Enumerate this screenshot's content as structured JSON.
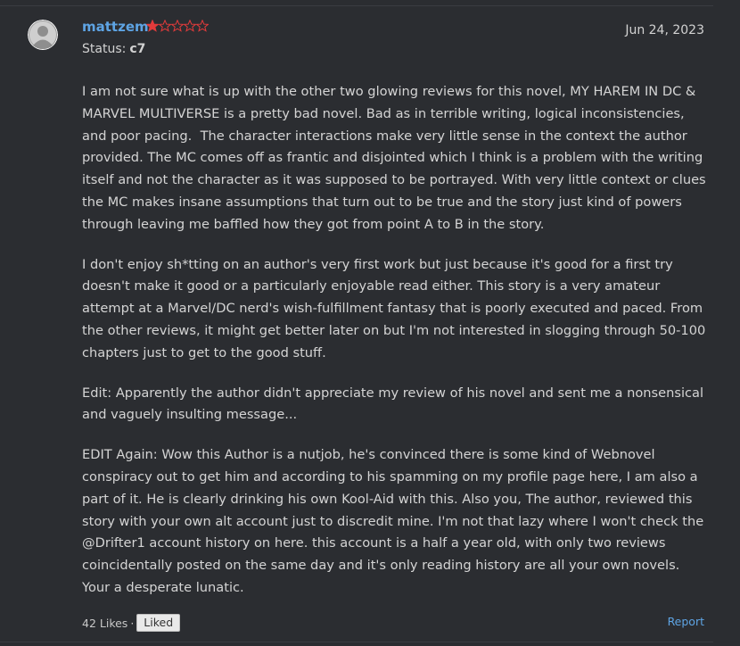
{
  "review": {
    "username": "mattzem",
    "rating": 1,
    "rating_max": 5,
    "status_label": "Status:",
    "status_value": "c7",
    "date": "Jun 24, 2023",
    "paragraphs": [
      "I am not sure what is up with the other two glowing reviews for this novel, MY HAREM IN DC & MARVEL MULTIVERSE is a pretty bad novel. Bad as in terrible writing, logical inconsistencies, and poor pacing.  The character interactions make very little sense in the context the author provided. The MC comes off as frantic and disjointed which I think is a problem with the writing itself and not the character as it was supposed to be portrayed. With very little context or clues the MC makes insane assumptions that turn out to be true and the story just kind of powers through leaving me baffled how they got from point A to B in the story.",
      "I don't enjoy sh*tting on an author's very first work but just because it's good for a first try doesn't make it good or a particularly enjoyable read either. This story is a very amateur attempt at a Marvel/DC nerd's wish-fulfillment fantasy that is poorly executed and paced. From the other reviews, it might get better later on but I'm not interested in slogging through 50-100 chapters just to get to the good stuff.",
      "Edit: Apparently the author didn't appreciate my review of his novel and sent me a nonsensical and vaguely insulting message...",
      "EDIT Again: Wow this Author is a nutjob, he's convinced there is some kind of Webnovel conspiracy out to get him and according to his spamming on my profile page here, I am also a part of it. He is clearly drinking his own Kool-Aid with this. Also you, The author, reviewed this story with your own alt account just to discredit mine. I'm not that lazy where I won't check the  @Drifter1 account history on here. this account is a half a year old, with only two reviews coincidentally posted on the same day and it's only reading history are all your own novels. Your a desperate lunatic."
    ],
    "likes_text": "42 Likes",
    "likes_separator": "·",
    "liked_button": "Liked",
    "report_link": "Report"
  },
  "colors": {
    "background": "#2b2d31",
    "username": "#5ea4e4",
    "star_filled": "#e23b3b",
    "star_empty": "#e23b3b",
    "link": "#5ea4e4"
  },
  "icons": {
    "avatar": "default-user-avatar-icon",
    "star_filled": "filled-star-icon",
    "star_empty": "empty-star-icon"
  }
}
